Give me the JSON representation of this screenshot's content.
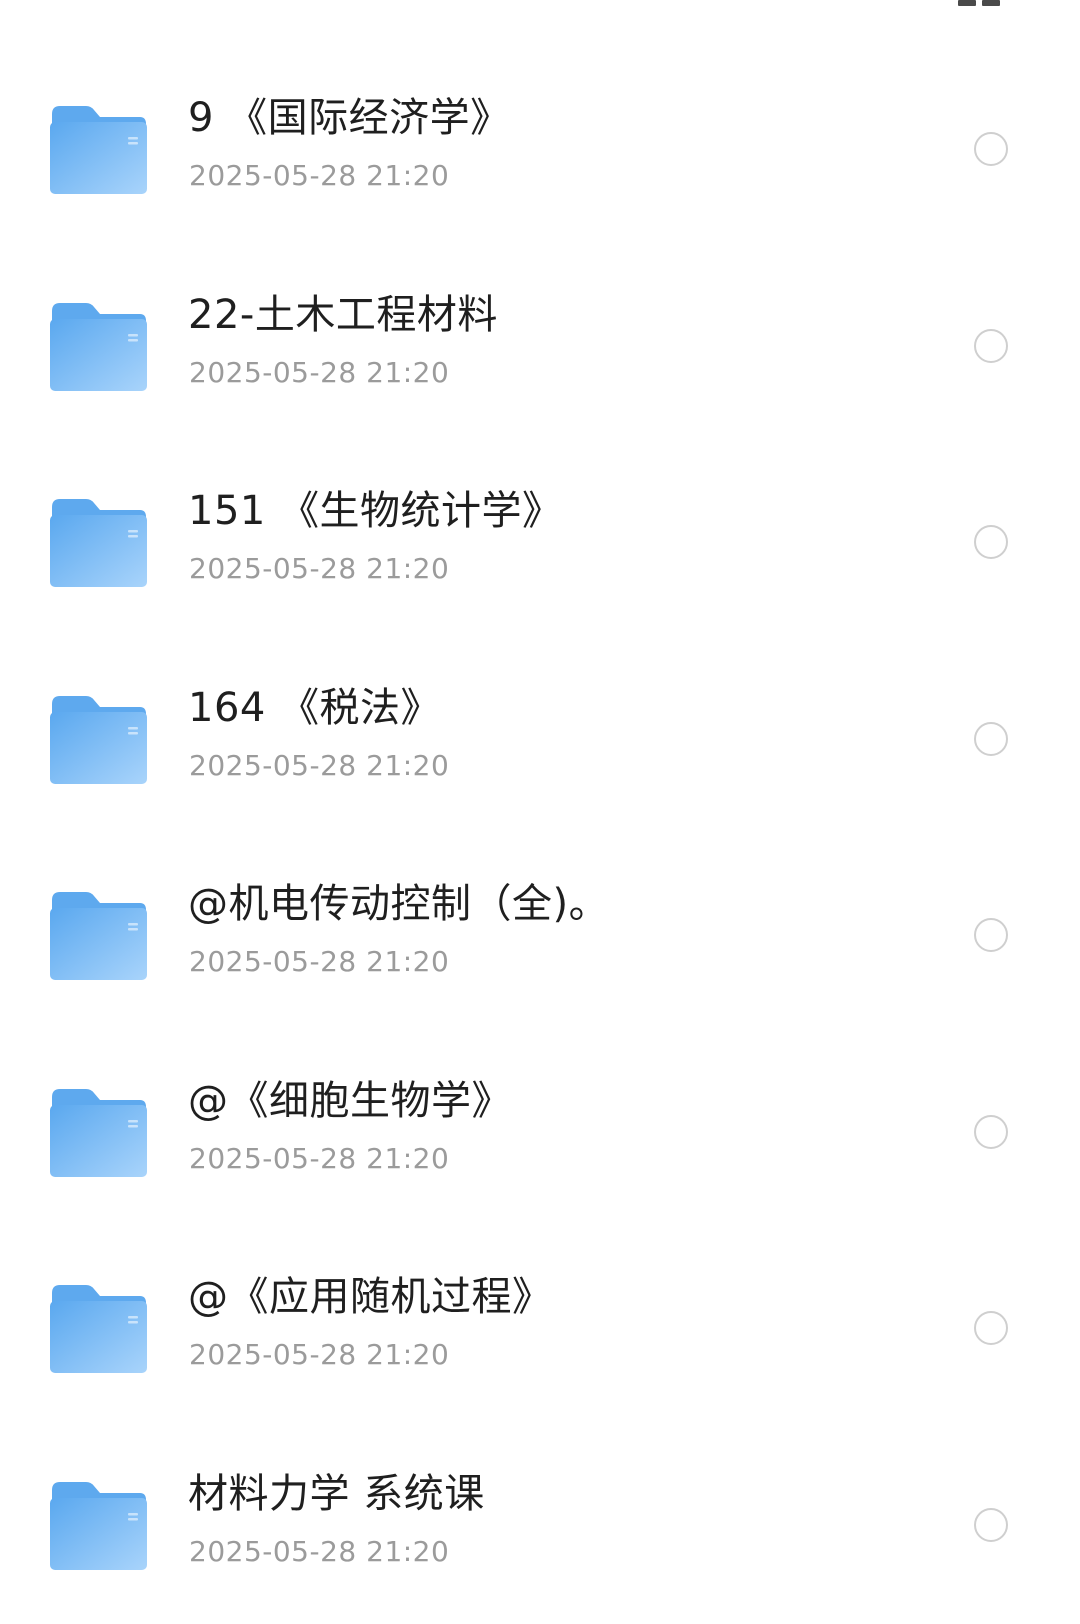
{
  "colors": {
    "folder_light": "#a9d4fb",
    "folder_dark": "#5aa8ef",
    "folder_tab": "#5ea9ee",
    "name_text": "#1f1f1f",
    "date_text": "#9b9b9b",
    "checkbox_border": "#cfcfcf"
  },
  "files": [
    {
      "icon": "folder-icon",
      "name": "9 《国际经济学》",
      "date": "2025-05-28 21:20"
    },
    {
      "icon": "folder-icon",
      "name": "22-土木工程材料",
      "date": "2025-05-28 21:20"
    },
    {
      "icon": "folder-icon",
      "name": "151 《生物统计学》",
      "date": "2025-05-28 21:20"
    },
    {
      "icon": "folder-icon",
      "name": "164 《税法》",
      "date": "2025-05-28 21:20"
    },
    {
      "icon": "folder-icon",
      "name": "@机电传动控制（全)。",
      "date": "2025-05-28 21:20"
    },
    {
      "icon": "folder-icon",
      "name": "@《细胞生物学》",
      "date": "2025-05-28 21:20"
    },
    {
      "icon": "folder-icon",
      "name": "@《应用随机过程》",
      "date": "2025-05-28 21:20"
    },
    {
      "icon": "folder-icon",
      "name": "材料力学 系统课",
      "date": "2025-05-28 21:20"
    }
  ]
}
